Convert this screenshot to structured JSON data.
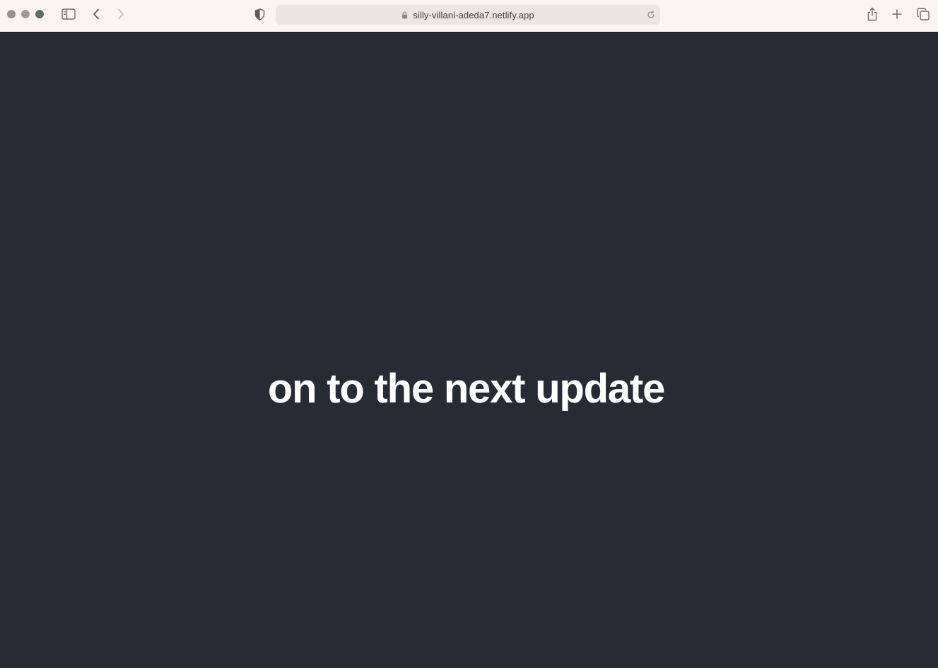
{
  "browser": {
    "url": "silly-villani-adeda7.netlify.app",
    "icons": {
      "close": "close-dot",
      "minimize": "minimize-dot",
      "zoom": "zoom-dot",
      "sidebar": "sidebar-icon",
      "back": "chevron-left-icon",
      "forward": "chevron-right-icon",
      "privacy": "shield-icon",
      "lock": "lock-icon",
      "reload": "reload-icon",
      "share": "share-icon",
      "new_tab": "plus-icon",
      "tabs_overview": "tabs-icon"
    },
    "colors": {
      "toolbar": "#fbf3f4",
      "address_bar": "#ebe5e6"
    }
  },
  "page": {
    "headline": "on to the next update",
    "colors": {
      "background": "#292b34",
      "text": "#ffffff"
    }
  }
}
